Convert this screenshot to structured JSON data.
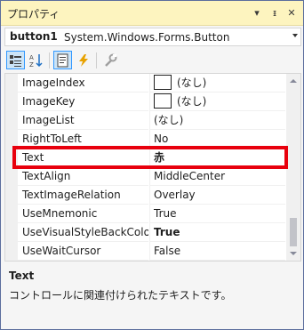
{
  "window": {
    "title": "プロパティ",
    "buttons": [
      "▾",
      "ᵻ",
      "✕"
    ]
  },
  "object_selector": {
    "name": "button1",
    "type": "System.Windows.Forms.Button"
  },
  "toolbar": {
    "icons": [
      "categorized-icon",
      "alphabetical-icon",
      "properties-icon",
      "events-icon",
      "property-pages-icon"
    ],
    "active": "properties-icon"
  },
  "properties": [
    {
      "name": "ImageIndex",
      "value": "(なし)",
      "swatch": true
    },
    {
      "name": "ImageKey",
      "value": "(なし)",
      "swatch": true
    },
    {
      "name": "ImageList",
      "value": "(なし)"
    },
    {
      "name": "RightToLeft",
      "value": "No"
    },
    {
      "name": "Text",
      "value": "赤",
      "bold": true,
      "selected": true
    },
    {
      "name": "TextAlign",
      "value": "MiddleCenter"
    },
    {
      "name": "TextImageRelation",
      "value": "Overlay"
    },
    {
      "name": "UseMnemonic",
      "value": "True"
    },
    {
      "name": "UseVisualStyleBackColo",
      "value": "True",
      "bold": true
    },
    {
      "name": "UseWaitCursor",
      "value": "False"
    }
  ],
  "description": {
    "title": "Text",
    "text": "コントロールに関連付けられたテキストです。"
  },
  "colors": {
    "title_bar": "#fdf4bf",
    "highlight": "#e8000d",
    "frame": "#5b6e9d"
  }
}
